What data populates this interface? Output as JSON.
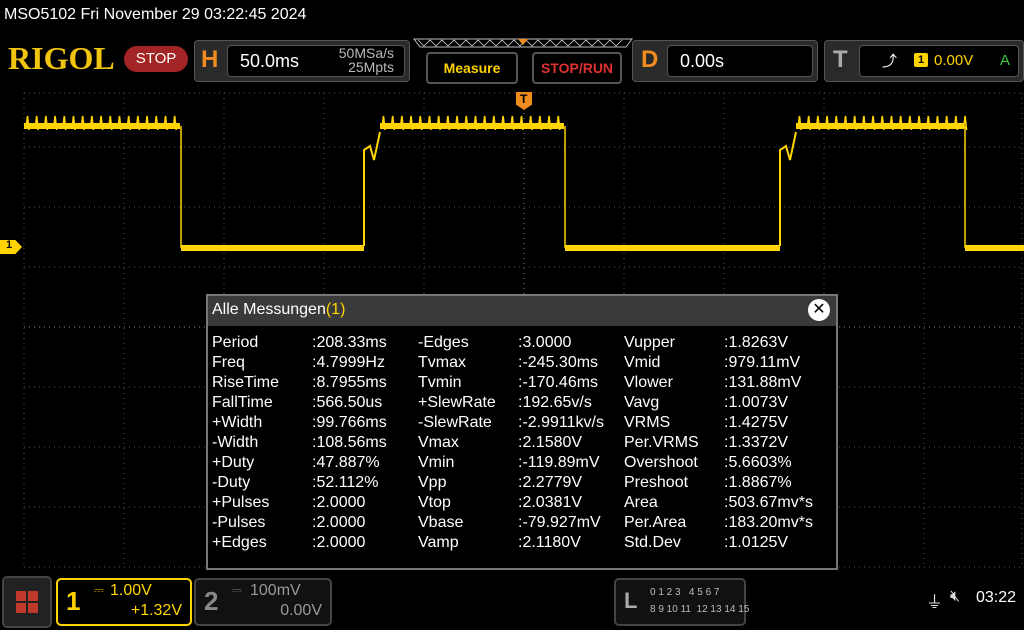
{
  "header": {
    "model_date": "MSO5102  Fri November 29 03:22:45 2024",
    "brand": "RIGOL",
    "run_state": "STOP",
    "h_label": "H",
    "timebase": "50.0ms",
    "sample_rate": "50MSa/s",
    "memory_depth": "25Mpts",
    "measure_btn": "Measure",
    "stoprun_btn": "STOP/RUN",
    "d_label": "D",
    "delay": "0.00s",
    "t_label": "T",
    "trig_source": "1",
    "trig_level": "0.00V",
    "trig_mode": "A"
  },
  "scope": {
    "ch1_marker": "1",
    "trig_marker": "T"
  },
  "dialog": {
    "title": "Alle Messungen",
    "title_index": "(1)",
    "col1": [
      {
        "name": "Period",
        "value": ":208.33ms"
      },
      {
        "name": "Freq",
        "value": ":4.7999Hz"
      },
      {
        "name": "RiseTime",
        "value": ":8.7955ms"
      },
      {
        "name": "FallTime",
        "value": ":566.50us"
      },
      {
        "name": "+Width",
        "value": ":99.766ms"
      },
      {
        "name": "-Width",
        "value": ":108.56ms"
      },
      {
        "name": "+Duty",
        "value": ":47.887%"
      },
      {
        "name": "-Duty",
        "value": ":52.112%"
      },
      {
        "name": "+Pulses",
        "value": ":2.0000"
      },
      {
        "name": "-Pulses",
        "value": ":2.0000"
      },
      {
        "name": "+Edges",
        "value": ":2.0000"
      }
    ],
    "col2": [
      {
        "name": "-Edges",
        "value": ":3.0000"
      },
      {
        "name": "Tvmax",
        "value": ":-245.30ms"
      },
      {
        "name": "Tvmin",
        "value": ":-170.46ms"
      },
      {
        "name": "+SlewRate",
        "value": ":192.65v/s"
      },
      {
        "name": "-SlewRate",
        "value": ":-2.9911kv/s"
      },
      {
        "name": "Vmax",
        "value": ":2.1580V"
      },
      {
        "name": "Vmin",
        "value": ":-119.89mV"
      },
      {
        "name": "Vpp",
        "value": ":2.2779V"
      },
      {
        "name": "Vtop",
        "value": ":2.0381V"
      },
      {
        "name": "Vbase",
        "value": ":-79.927mV"
      },
      {
        "name": "Vamp",
        "value": ":2.1180V"
      }
    ],
    "col3": [
      {
        "name": "Vupper",
        "value": ":1.8263V"
      },
      {
        "name": "Vmid",
        "value": ":979.11mV"
      },
      {
        "name": "Vlower",
        "value": ":131.88mV"
      },
      {
        "name": "Vavg",
        "value": ":1.0073V"
      },
      {
        "name": "VRMS",
        "value": ":1.4275V"
      },
      {
        "name": "Per.VRMS",
        "value": ":1.3372V"
      },
      {
        "name": "Overshoot",
        "value": ":5.6603%"
      },
      {
        "name": "Preshoot",
        "value": ":1.8867%"
      },
      {
        "name": "Area",
        "value": ":503.67mv*s"
      },
      {
        "name": "Per.Area",
        "value": ":183.20mv*s"
      },
      {
        "name": "Std.Dev",
        "value": ":1.0125V"
      }
    ]
  },
  "bottom": {
    "ch1_num": "1",
    "ch1_scale": "1.00V",
    "ch1_offset": "+1.32V",
    "ch2_num": "2",
    "ch2_scale": "100mV",
    "ch2_offset": "0.00V",
    "la_label": "L",
    "la_row1": "0 1 2 3   4 5 6 7",
    "la_row2": "8 9 10 11  12 13 14 15",
    "time": "03:22"
  },
  "colors": {
    "ch1": "#ffd400",
    "accent_orange": "#f08c1f",
    "stop_red": "#a32424"
  }
}
